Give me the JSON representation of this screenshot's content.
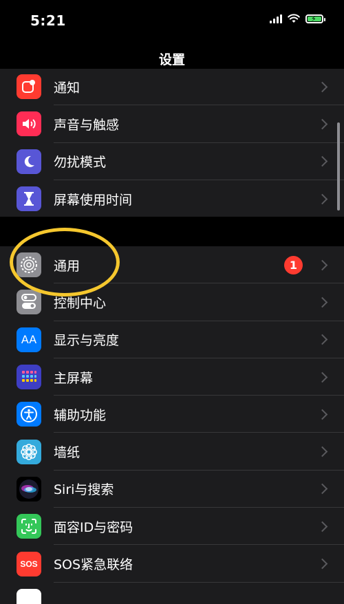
{
  "status_bar": {
    "time": "5:21"
  },
  "header": {
    "title": "设置"
  },
  "group1": [
    {
      "name": "notifications",
      "label": "通知",
      "icon": "notification-icon",
      "color": "#ff3b30"
    },
    {
      "name": "sounds",
      "label": "声音与触感",
      "icon": "speaker-icon",
      "color": "#ff2d55"
    },
    {
      "name": "dnd",
      "label": "勿扰模式",
      "icon": "moon-icon",
      "color": "#5856d6"
    },
    {
      "name": "screentime",
      "label": "屏幕使用时间",
      "icon": "hourglass-icon",
      "color": "#5856d6"
    }
  ],
  "group2": [
    {
      "name": "general",
      "label": "通用",
      "icon": "gear-icon",
      "color": "#8e8e93",
      "badge": "1"
    },
    {
      "name": "control-center",
      "label": "控制中心",
      "icon": "toggle-icon",
      "color": "#8e8e93"
    },
    {
      "name": "display",
      "label": "显示与亮度",
      "icon": "text-size-icon",
      "color": "#007aff"
    },
    {
      "name": "home-screen",
      "label": "主屏幕",
      "icon": "app-grid-icon",
      "color": "#3e3ec4"
    },
    {
      "name": "accessibility",
      "label": "辅助功能",
      "icon": "accessibility-icon",
      "color": "#007aff"
    },
    {
      "name": "wallpaper",
      "label": "墙纸",
      "icon": "flower-icon",
      "color": "#34aadc"
    },
    {
      "name": "siri",
      "label": "Siri与搜索",
      "icon": "siri-icon",
      "color": "#1c1c1e"
    },
    {
      "name": "faceid",
      "label": "面容ID与密码",
      "icon": "face-id-icon",
      "color": "#34c759"
    },
    {
      "name": "sos",
      "label": "SOS紧急联络",
      "icon": "sos-icon",
      "color": "#ff3b30",
      "icon_text": "SOS"
    }
  ],
  "annotation": {
    "color": "#f5c72e"
  }
}
